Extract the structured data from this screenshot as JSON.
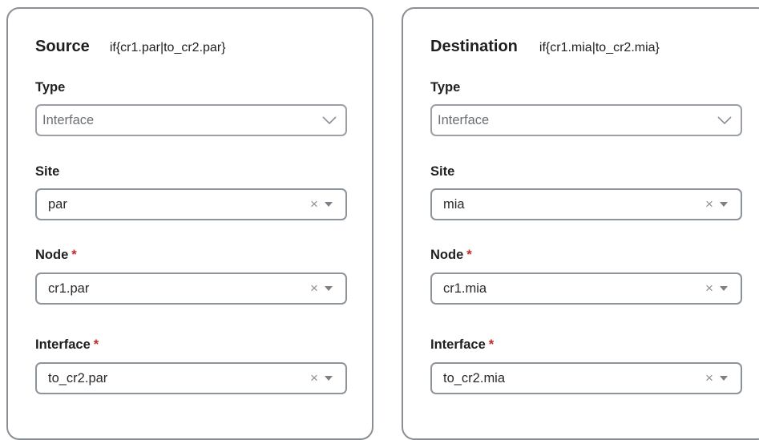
{
  "source": {
    "title": "Source",
    "subtitle": "if{cr1.par|to_cr2.par}",
    "type": {
      "label": "Type",
      "value": "Interface"
    },
    "site": {
      "label": "Site",
      "value": "par"
    },
    "node": {
      "label": "Node",
      "required_mark": "*",
      "value": "cr1.par"
    },
    "interface": {
      "label": "Interface",
      "required_mark": "*",
      "value": "to_cr2.par"
    }
  },
  "destination": {
    "title": "Destination",
    "subtitle": "if{cr1.mia|to_cr2.mia}",
    "type": {
      "label": "Type",
      "value": "Interface"
    },
    "site": {
      "label": "Site",
      "value": "mia"
    },
    "node": {
      "label": "Node",
      "required_mark": "*",
      "value": "cr1.mia"
    },
    "interface": {
      "label": "Interface",
      "required_mark": "*",
      "value": "to_cr2.mia"
    }
  },
  "icons": {
    "clear": "×",
    "chevron": "chevron-down-icon",
    "caret": "caret-down-icon"
  },
  "colors": {
    "border": "#8e949b",
    "required": "#c62828",
    "placeholder_text": "#6b6f75"
  }
}
